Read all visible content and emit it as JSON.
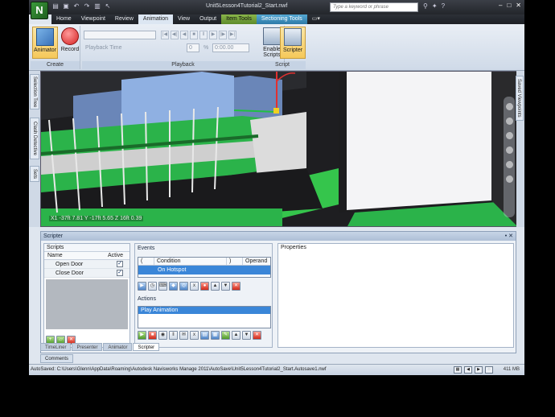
{
  "window": {
    "title": "Unit5Lesson4Tutorial2_Start.nwf",
    "search_placeholder": "Type a keyword or phrase",
    "logo_letter": "N"
  },
  "tabs": [
    "Home",
    "Viewpoint",
    "Review",
    "Animation",
    "View",
    "Output",
    "Item Tools",
    "Sectioning Tools"
  ],
  "ribbon": {
    "create": {
      "label": "Create",
      "animator": "Animator",
      "record": "Record"
    },
    "playback": {
      "label": "Playback",
      "time_label": "Playback Time",
      "zero": "0",
      "percent": "%",
      "time": "0:00.00"
    },
    "script": {
      "label": "Script",
      "enable": "Enable Scripts",
      "scripter": "Scripter"
    }
  },
  "left_tabs": [
    "Selection Tree",
    "Clash Detective",
    "Sets"
  ],
  "right_tabs": [
    "Saved Viewpoints"
  ],
  "viewport": {
    "coords": "X1 -37ft 7.81  Y -17ft 5.65  Z 16ft 0.39"
  },
  "scripter": {
    "title": "Scripter",
    "controls": "• ✕",
    "scripts": {
      "label": "Scripts",
      "col_name": "Name",
      "col_active": "Active",
      "rows": [
        {
          "name": "Open Door",
          "active": "✓"
        },
        {
          "name": "Close Door",
          "active": "✓"
        }
      ]
    },
    "events": {
      "label": "Events",
      "col_open": "(",
      "col_condition": "Condition",
      "col_close": ")",
      "col_operand": "Operand",
      "row": "On Hotspot"
    },
    "actions": {
      "label": "Actions",
      "row": "Play Animation"
    },
    "properties": {
      "label": "Properties"
    }
  },
  "bottom_tabs": [
    "TimeLiner",
    "Presenter",
    "Animator",
    "Scripter"
  ],
  "comments_tab": "Comments",
  "status": {
    "text": "AutoSaved: C:\\Users\\Glenn\\AppData\\Roaming\\Autodesk Navisworks Manage 2011\\AutoSave\\Unit5Lesson4Tutorial2_Start.Autosave1.nwf",
    "memory": "411 MB"
  }
}
